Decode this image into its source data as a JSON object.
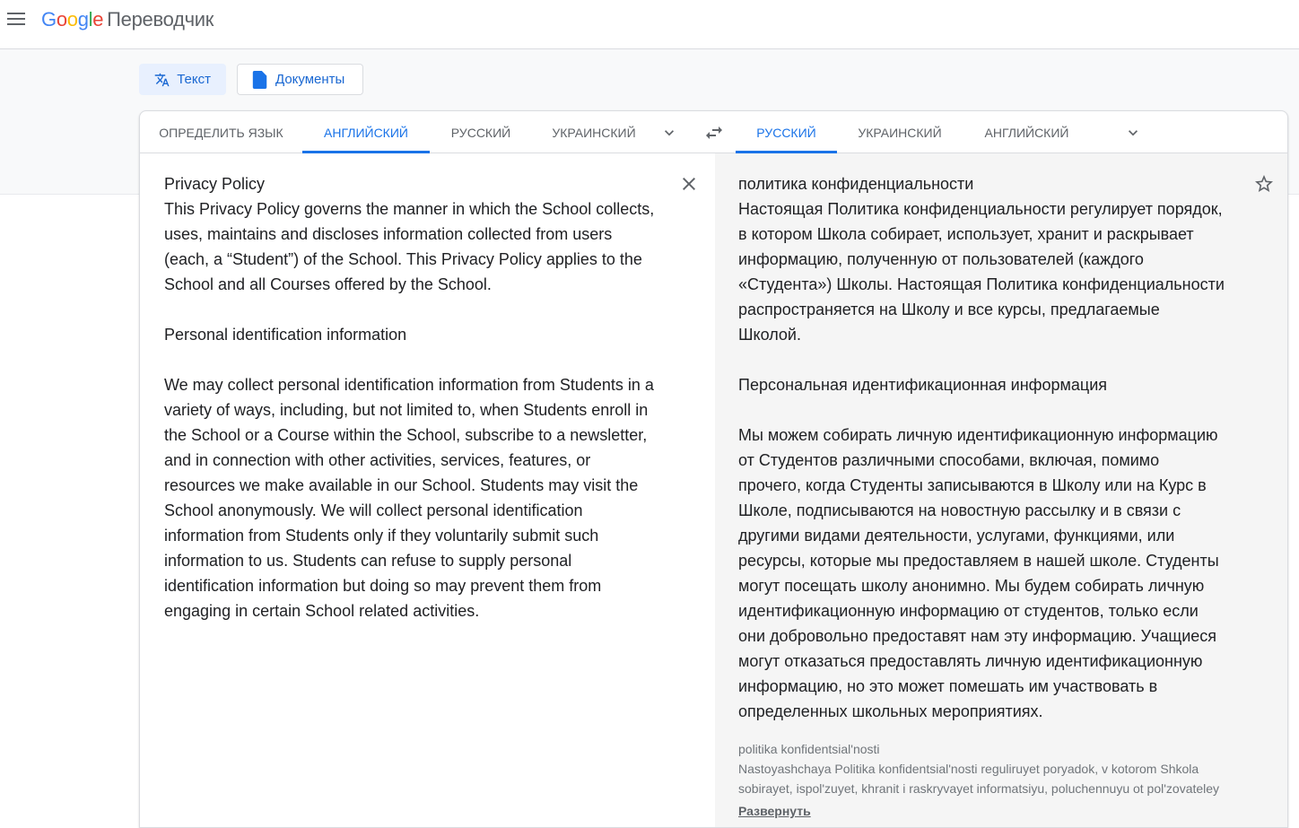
{
  "header": {
    "logo": "Google",
    "product": "Переводчик"
  },
  "modes": {
    "text": "Текст",
    "documents": "Документы"
  },
  "source_langs": [
    "ОПРЕДЕЛИТЬ ЯЗЫК",
    "АНГЛИЙСКИЙ",
    "РУССКИЙ",
    "УКРАИНСКИЙ"
  ],
  "target_langs": [
    "РУССКИЙ",
    "УКРАИНСКИЙ",
    "АНГЛИЙСКИЙ"
  ],
  "source_text": "Privacy Policy\nThis Privacy Policy governs the manner in which the School collects,\nuses, maintains and discloses information collected from users\n(each, a “Student”) of the School. This Privacy Policy applies to the\nSchool and all Courses offered by the School.\n\nPersonal identification information\n\nWe may collect personal identification information from Students in a\nvariety of ways, including, but not limited to, when Students enroll in\nthe School or a Course within the School, subscribe to a newsletter,\nand in connection with other activities, services, features, or\nresources we make available in our School. Students may visit the\nSchool anonymously. We will collect personal identification\ninformation from Students only if they voluntarily submit such\ninformation to us. Students can refuse to supply personal\nidentification information but doing so may prevent them from\nengaging in certain School related activities.",
  "translated_text": "политика конфиденциальности\nНастоящая Политика конфиденциальности регулирует порядок,\nв котором Школа собирает, использует, хранит и раскрывает\nинформацию, полученную от пользователей (каждого\n«Студента») Школы. Настоящая Политика конфиденциальности\nраспространяется на Школу и все курсы, предлагаемые\nШколой.\n\nПерсональная идентификационная информация\n\nМы можем собирать личную идентификационную информацию\nот Студентов различными способами, включая, помимо\nпрочего, когда Студенты записываются в Школу или на Курс в\nШколе, подписываются на новостную рассылку и в связи с\nдругими видами деятельности, услугами, функциями, или\nресурсы, которые мы предоставляем в нашей школе. Студенты\nмогут посещать школу анонимно. Мы будем собирать личную\nидентификационную информацию от студентов, только если\nони добровольно предоставят нам эту информацию. Учащиеся\nмогут отказаться предоставлять личную идентификационную\nинформацию, но это может помешать им участвовать в\nопределенных школьных мероприятиях.",
  "transliteration": "politika konfidentsial'nosti\nNastoyashchaya Politika konfidentsial'nosti reguliruyet poryadok, v kotorom Shkola\nsobirayet, ispol'zuyet, khranit i raskryvayet informatsiyu, poluchennuyu ot pol'zovateley",
  "expand_label": "Развернуть"
}
